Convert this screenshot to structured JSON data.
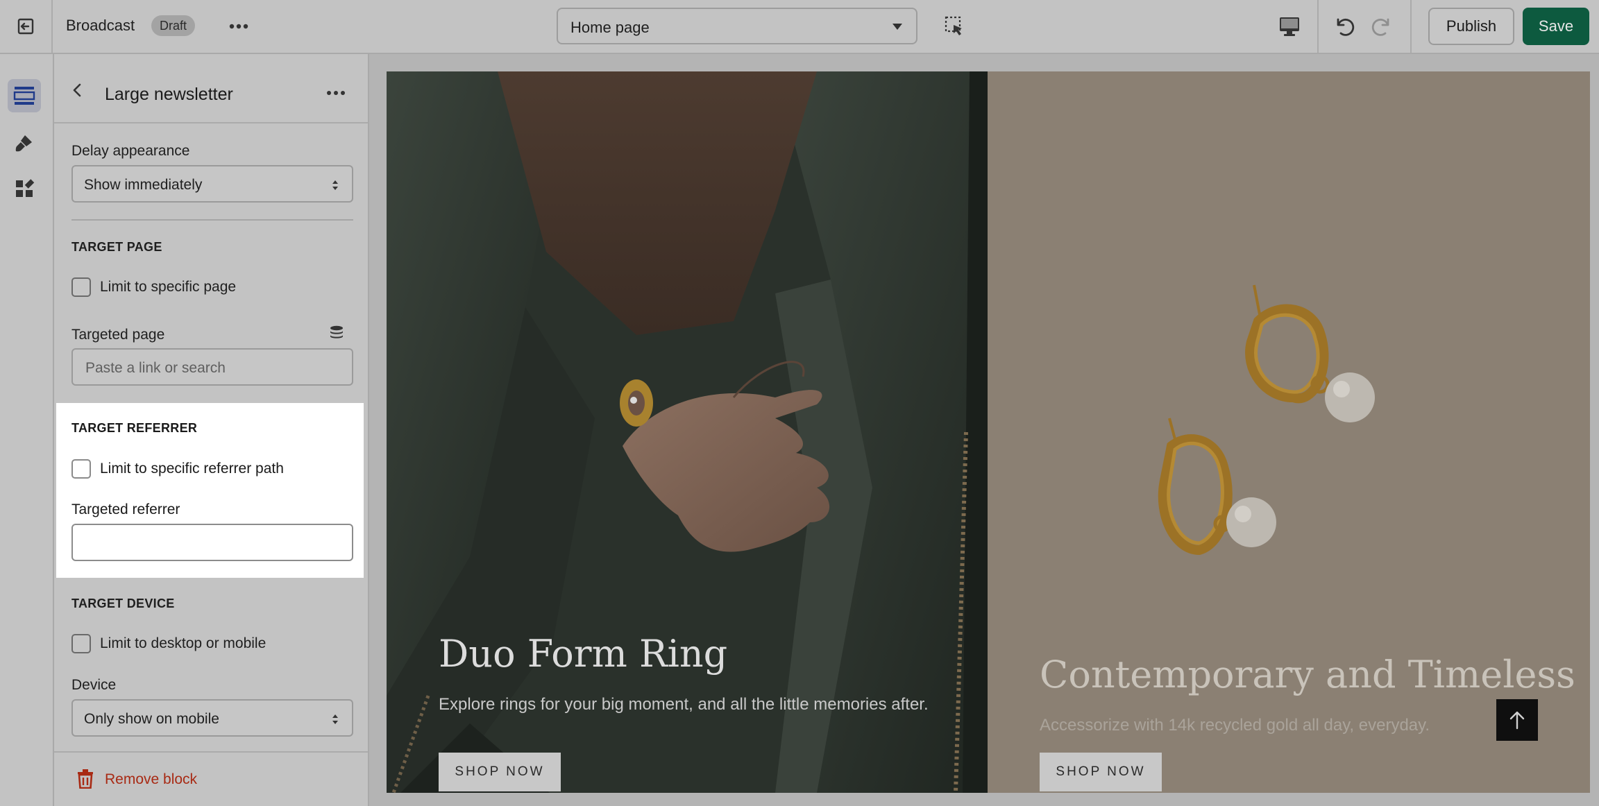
{
  "topbar": {
    "store_name": "Broadcast",
    "status_badge": "Draft",
    "page_select": "Home page",
    "publish_label": "Publish",
    "save_label": "Save",
    "save_color": "#0d5a3f"
  },
  "rail": {
    "items": [
      "sections-icon",
      "theme-settings-icon",
      "apps-icon"
    ]
  },
  "panel": {
    "title": "Large newsletter",
    "delay": {
      "label": "Delay appearance",
      "value": "Show immediately"
    },
    "target_page": {
      "heading": "TARGET PAGE",
      "checkbox_label": "Limit to specific page",
      "field_label": "Targeted page",
      "placeholder": "Paste a link or search"
    },
    "target_referrer": {
      "heading": "TARGET REFERRER",
      "checkbox_label": "Limit to specific referrer path",
      "field_label": "Targeted referrer",
      "value": ""
    },
    "target_device": {
      "heading": "TARGET DEVICE",
      "checkbox_label": "Limit to desktop or mobile",
      "field_label": "Device",
      "value": "Only show on mobile"
    },
    "remove_label": "Remove block",
    "remove_color": "#a82a14"
  },
  "preview": {
    "left": {
      "title": "Duo Form Ring",
      "subtitle": "Explore rings for your big moment, and all the little memories after.",
      "button": "SHOP NOW"
    },
    "right": {
      "title": "Contemporary and Timeless",
      "subtitle": "Accessorize with 14k recycled gold all day, everyday.",
      "button": "SHOP NOW"
    }
  }
}
